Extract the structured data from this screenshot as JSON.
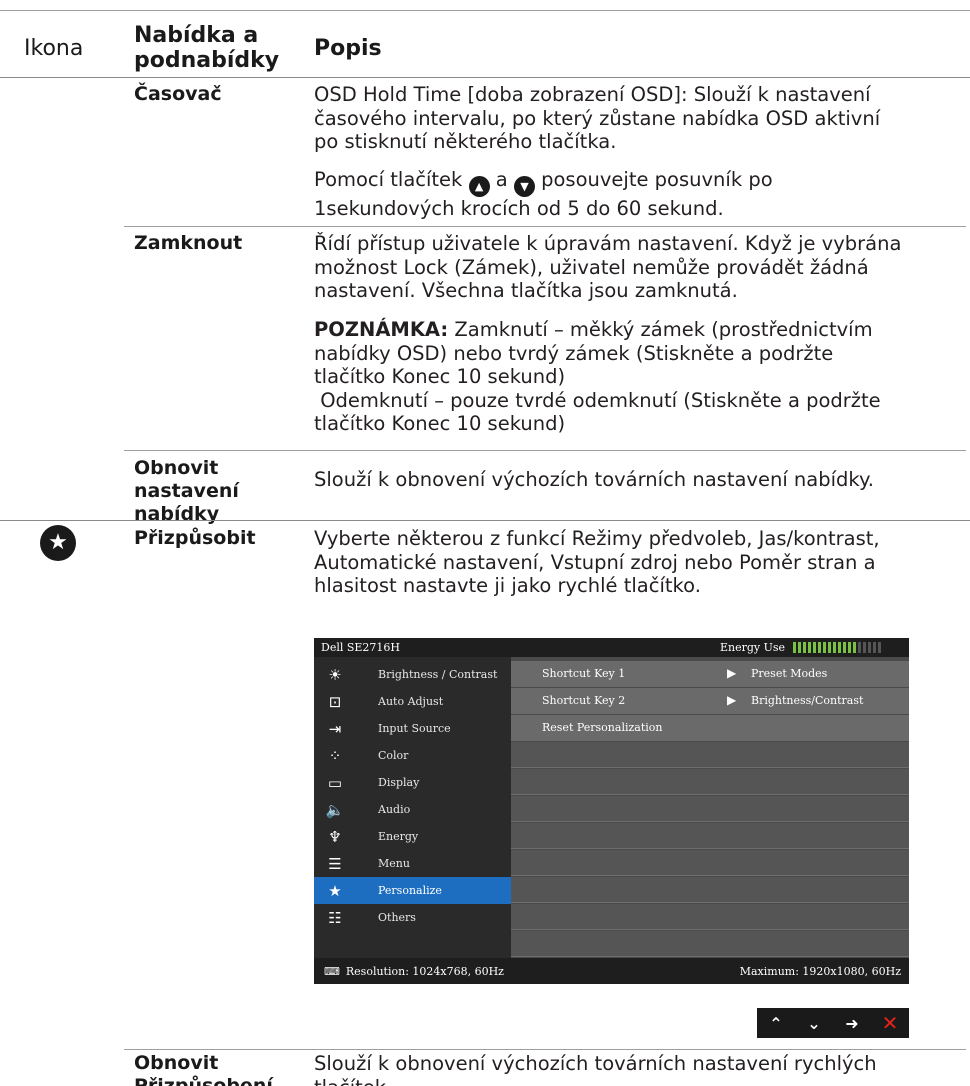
{
  "header": {
    "col1": "Ikona",
    "col2_line1": "Nabídka a",
    "col2_line2": "podnabídky",
    "col3": "Popis"
  },
  "rows": {
    "casovac": {
      "label": "Časovač",
      "p1_l1": "OSD Hold Time [doba zobrazení OSD]: Slouží k nastavení",
      "p1_l2": "časového intervalu, po který zůstane nabídka OSD aktivní",
      "p1_l3": "po stisknutí některého tlačítka.",
      "p2_a": "Pomocí tlačítek",
      "p2_b": "a",
      "p2_c": "posouvejte posuvník po",
      "p2_l2": "1sekundových krocích od 5 do 60 sekund."
    },
    "zamknout": {
      "label": "Zamknout",
      "p1_l1": "Řídí přístup uživatele k úpravám nastavení. Když je vybrána",
      "p1_l2": "možnost Lock (Zámek), uživatel nemůže provádět žádná",
      "p1_l3": "nastavení. Všechna tlačítka jsou zamknutá.",
      "note_label": "POZNÁMKA:",
      "note_l1": " Zamknutí – měkký zámek (prostřednictvím",
      "note_l2": "nabídky OSD) nebo tvrdý zámek (Stiskněte a podržte",
      "note_l3": "tlačítko Konec 10 sekund)",
      "note_l4": " Odemknutí – pouze tvrdé odemknutí (Stiskněte a podržte",
      "note_l5": "tlačítko Konec 10 sekund)"
    },
    "obnovit_menu": {
      "label_l1": "Obnovit",
      "label_l2": "nastavení",
      "label_l3": "nabídky",
      "text": "Slouží k obnovení výchozích továrních nastavení nabídky."
    },
    "prizpusobit": {
      "icon": "star-icon",
      "label": "Přizpůsobit",
      "p1_l1": "Vyberte některou z funkcí Režimy předvoleb, Jas/kontrast,",
      "p1_l2": "Automatické nastavení, Vstupní zdroj nebo Poměr stran a",
      "p1_l3": "hlasitost nastavte ji jako rychlé tlačítko."
    },
    "obnovit_prizpusobeni": {
      "label_l1": "Obnovit",
      "label_l2": "Přizpůsobení",
      "text_l1": "Slouží k obnovení výchozích továrních nastavení rychlých",
      "text_l2": "tlačítek."
    }
  },
  "osd": {
    "title": "Dell SE2716H",
    "energy_label": "Energy Use",
    "energy_level": 0.72,
    "menu": [
      {
        "icon": "brightness-icon",
        "glyph": "☀",
        "label": "Brightness / Contrast"
      },
      {
        "icon": "auto-adjust-icon",
        "glyph": "⊡",
        "label": "Auto Adjust"
      },
      {
        "icon": "input-source-icon",
        "glyph": "⇥",
        "label": "Input Source"
      },
      {
        "icon": "color-icon",
        "glyph": "⁘",
        "label": "Color"
      },
      {
        "icon": "display-icon",
        "glyph": "▭",
        "label": "Display"
      },
      {
        "icon": "audio-icon",
        "glyph": "🔈",
        "label": "Audio"
      },
      {
        "icon": "energy-icon",
        "glyph": "♆",
        "label": "Energy"
      },
      {
        "icon": "menu-icon",
        "glyph": "☰",
        "label": "Menu"
      },
      {
        "icon": "personalize-icon",
        "glyph": "★",
        "label": "Personalize"
      },
      {
        "icon": "others-icon",
        "glyph": "☷",
        "label": "Others"
      }
    ],
    "active_index": 8,
    "settings": [
      {
        "key": "Shortcut Key 1",
        "value": "Preset Modes"
      },
      {
        "key": "Shortcut Key 2",
        "value": "Brightness/Contrast"
      },
      {
        "key": "Reset Personalization",
        "value": ""
      }
    ],
    "resolution": "Resolution: 1024x768, 60Hz",
    "maximum": "Maximum: 1920x1080, 60Hz",
    "nav": [
      "up-icon",
      "down-icon",
      "enter-icon",
      "exit-icon"
    ]
  }
}
